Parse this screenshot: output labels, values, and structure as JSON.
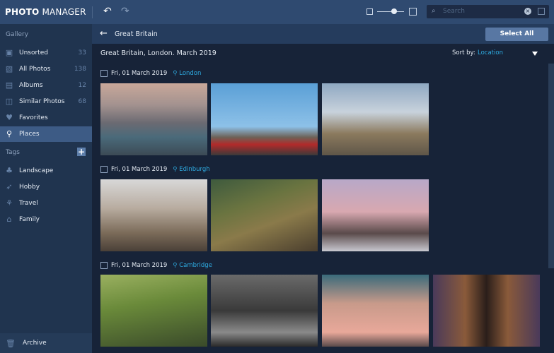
{
  "app": {
    "title_bold": "PHOTO",
    "title_rest": " MANAGER"
  },
  "search": {
    "placeholder": "Search"
  },
  "sidebar": {
    "gallery_label": "Gallery",
    "tags_label": "Tags",
    "items": [
      {
        "label": "Unsorted",
        "count": "33",
        "icon": "camera-icon"
      },
      {
        "label": "All Photos",
        "count": "138",
        "icon": "image-icon"
      },
      {
        "label": "Albums",
        "count": "12",
        "icon": "album-icon"
      },
      {
        "label": "Similar Photos",
        "count": "68",
        "icon": "similar-icon"
      },
      {
        "label": "Favorites",
        "count": "",
        "icon": "heart-icon"
      },
      {
        "label": "Places",
        "count": "",
        "icon": "pin-icon"
      }
    ],
    "tags": [
      {
        "label": "Landscape"
      },
      {
        "label": "Hobby"
      },
      {
        "label": "Travel"
      },
      {
        "label": "Family"
      }
    ],
    "archive": "Archive"
  },
  "header": {
    "breadcrumb": "Great Britain",
    "select_all": "Select All"
  },
  "main": {
    "title": "Great Britain, London. March 2019",
    "sort_label": "Sort by:",
    "sort_value": "Location",
    "groups": [
      {
        "date": "Fri, 01 March 2019",
        "location": "London"
      },
      {
        "date": "Fri, 01 March 2019",
        "location": "Edinburgh"
      },
      {
        "date": "Fri, 01 March 2019",
        "location": "Cambridge"
      }
    ]
  },
  "colors": {
    "accent": "#2eaae0",
    "active": "#3d5b85"
  }
}
